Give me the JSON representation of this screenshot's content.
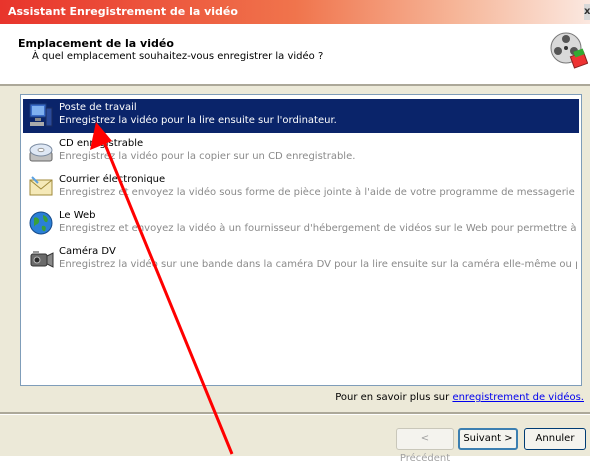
{
  "window": {
    "title": "Assistant Enregistrement de la vidéo",
    "close_glyph": "x"
  },
  "header": {
    "title": "Emplacement de la vidéo",
    "subtitle": "À quel emplacement souhaitez-vous enregistrer la vidéo ?",
    "icon": "film-reel-icon"
  },
  "options": [
    {
      "title": "Poste de travail",
      "description": "Enregistrez la vidéo pour la lire ensuite sur l'ordinateur.",
      "icon": "computer-icon",
      "selected": true
    },
    {
      "title": "CD enregistrable",
      "description": "Enregistrez la vidéo pour la copier sur un CD enregistrable.",
      "icon": "cd-icon",
      "selected": false
    },
    {
      "title": "Courrier électronique",
      "description": "Enregistrez et envoyez la vidéo sous forme de pièce jointe à l'aide de votre programme de messagerie par défaut.",
      "icon": "envelope-icon",
      "selected": false
    },
    {
      "title": "Le Web",
      "description": "Enregistrez et envoyez la vidéo à un fournisseur d'hébergement de vidéos sur le Web pour permettre à d'autres personn…",
      "icon": "globe-icon",
      "selected": false
    },
    {
      "title": "Caméra DV",
      "description": "Enregistrez la vidéo sur une bande dans la caméra DV pour la lire ensuite sur la caméra elle-même ou pour la regarder sur …",
      "icon": "camcorder-icon",
      "selected": false
    }
  ],
  "footer": {
    "learn_more_prefix": "Pour en savoir plus sur ",
    "learn_more_link": "enregistrement de vidéos."
  },
  "buttons": {
    "previous": "< Précédent",
    "next": "Suivant >",
    "cancel": "Annuler"
  },
  "colors": {
    "selection": "#0a246a",
    "annotation_arrow": "#ff0000"
  }
}
